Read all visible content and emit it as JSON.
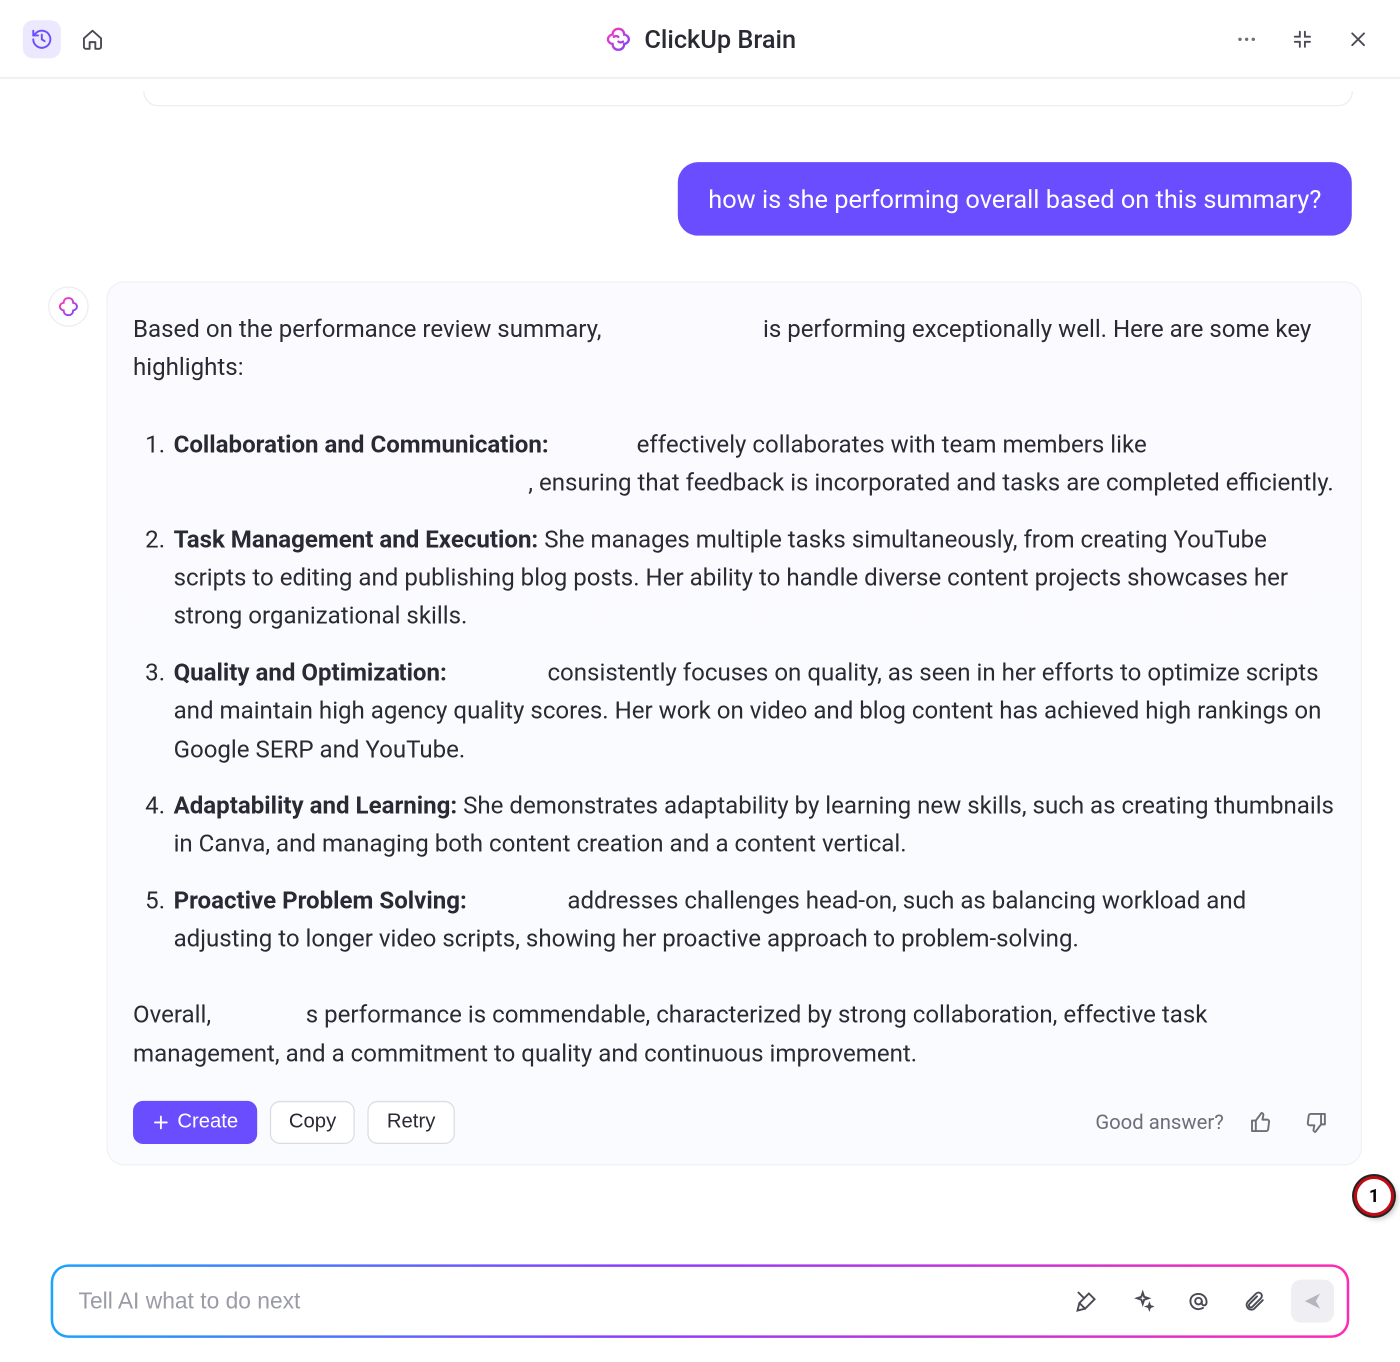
{
  "header": {
    "title": "ClickUp Brain"
  },
  "conversation": {
    "user_message": "how is she performing overall based on this summary?",
    "assistant_intro_before": "Based on the performance review summary,",
    "assistant_intro_after": "is performing exceptionally well. Here are some key highlights:",
    "highlights": [
      {
        "title": "Collaboration and Communication:",
        "body_before": "effectively collaborates with team members like",
        "body_after": ", ensuring that feedback is incorporated and tasks are completed efficiently."
      },
      {
        "title": "Task Management and Execution:",
        "body": "She manages multiple tasks simultaneously, from creating YouTube scripts to editing and publishing blog posts. Her ability to handle diverse content projects showcases her strong organizational skills."
      },
      {
        "title": "Quality and Optimization:",
        "body_after": "consistently focuses on quality, as seen in her efforts to optimize scripts and maintain high agency quality scores. Her work on video and blog content has achieved high rankings on Google SERP and YouTube."
      },
      {
        "title": "Adaptability and Learning:",
        "body": "She demonstrates adaptability by learning new skills, such as creating thumbnails in Canva, and managing both content creation and a content vertical."
      },
      {
        "title": "Proactive Problem Solving:",
        "body_after": "addresses challenges head-on, such as balancing workload and adjusting to longer video scripts, showing her proactive approach to problem-solving."
      }
    ],
    "outro_before": "Overall,",
    "outro_after": "s performance is commendable, characterized by strong collaboration, effective task management, and a commitment to quality and continuous improvement."
  },
  "actions": {
    "create_label": "Create",
    "copy_label": "Copy",
    "retry_label": "Retry",
    "feedback_label": "Good answer?"
  },
  "composer": {
    "placeholder": "Tell AI what to do next"
  },
  "marker": {
    "number": "1"
  }
}
